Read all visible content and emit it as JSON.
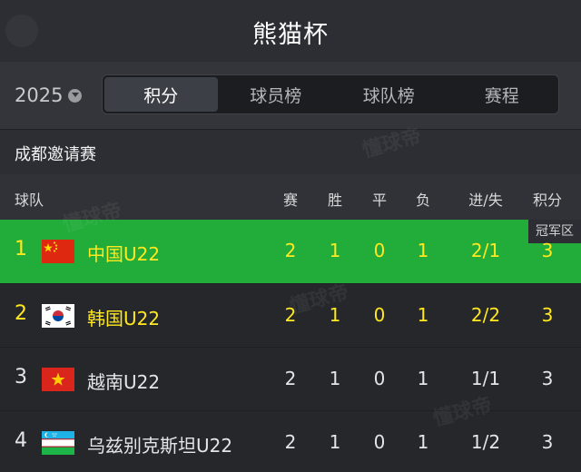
{
  "header": {
    "title": "熊猫杯"
  },
  "filter": {
    "year": "2025",
    "tabs": [
      {
        "label": "积分",
        "active": true
      },
      {
        "label": "球员榜",
        "active": false
      },
      {
        "label": "球队榜",
        "active": false
      },
      {
        "label": "赛程",
        "active": false
      }
    ]
  },
  "section": {
    "label": "成都邀请赛"
  },
  "table": {
    "headers": {
      "team": "球队",
      "played": "赛",
      "won": "胜",
      "drawn": "平",
      "lost": "负",
      "goals": "进/失",
      "points": "积分"
    },
    "zone_badge": "冠军区",
    "rows": [
      {
        "rank": "1",
        "team": "中国U22",
        "flag": "china-flag",
        "played": "2",
        "won": "1",
        "drawn": "0",
        "lost": "1",
        "goals": "2/1",
        "points": "3"
      },
      {
        "rank": "2",
        "team": "韩国U22",
        "flag": "korea-flag",
        "played": "2",
        "won": "1",
        "drawn": "0",
        "lost": "1",
        "goals": "2/2",
        "points": "3"
      },
      {
        "rank": "3",
        "team": "越南U22",
        "flag": "vietnam-flag",
        "played": "2",
        "won": "1",
        "drawn": "0",
        "lost": "1",
        "goals": "1/1",
        "points": "3"
      },
      {
        "rank": "4",
        "team": "乌兹别克斯坦U22",
        "flag": "uzbekistan-flag",
        "played": "2",
        "won": "1",
        "drawn": "0",
        "lost": "1",
        "goals": "1/2",
        "points": "3"
      }
    ]
  },
  "watermark": "懂球帝",
  "colors": {
    "zone_green": "#22ac39",
    "highlight_yellow": "#ffe820",
    "background": "#25272b"
  }
}
